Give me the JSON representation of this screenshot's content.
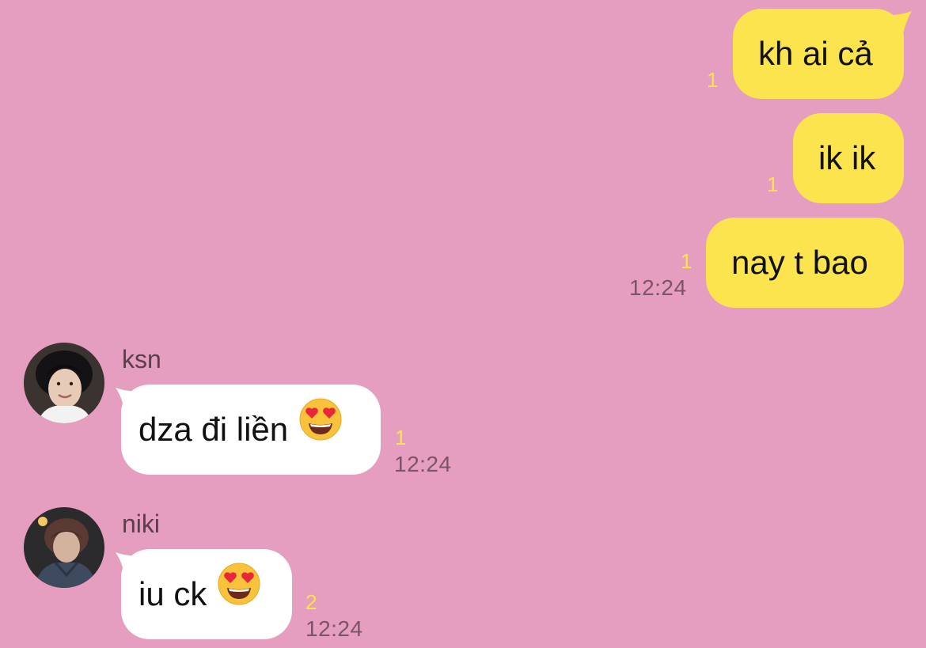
{
  "colors": {
    "background": "#e59ebf",
    "outgoing_bubble": "#fbe44d",
    "incoming_bubble": "#ffffff",
    "unread_count": "#fbe44d",
    "timestamp": "#7a5566"
  },
  "outgoing": [
    {
      "text": "kh ai cả",
      "unread": "1"
    },
    {
      "text": "ik ik",
      "unread": "1"
    },
    {
      "text": "nay t bao",
      "unread": "1",
      "time": "12:24"
    }
  ],
  "incoming": [
    {
      "sender": "ksn",
      "avatar_icon": "profile-photo",
      "text": "dza đi liền",
      "emoji": "heart-eyes-emoji",
      "unread": "1",
      "time": "12:24"
    },
    {
      "sender": "niki",
      "avatar_icon": "profile-photo",
      "text": "iu ck",
      "emoji": "heart-eyes-emoji",
      "unread": "2",
      "time": "12:24"
    }
  ]
}
